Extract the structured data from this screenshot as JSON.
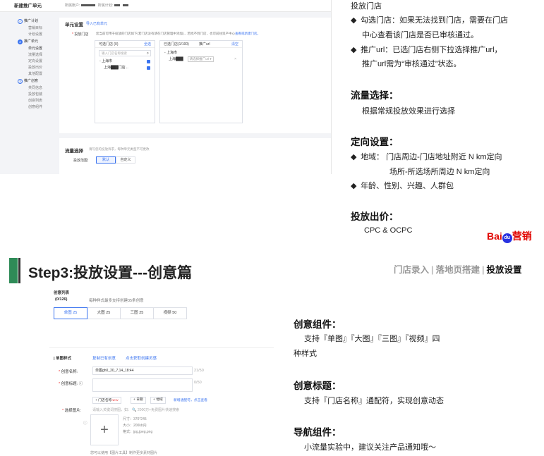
{
  "top_shot": {
    "header_title": "新建推广单元",
    "account_label": "所属账户:",
    "plan_label": "所属计划:",
    "sidebar": {
      "steps": [
        {
          "num": "✓",
          "label": "推广计划",
          "subs": [
            "营销目标",
            "计划设置"
          ]
        },
        {
          "num": "2",
          "label": "推广单元",
          "subs": [
            "单元设置",
            "流量选择",
            "定向设置",
            "投放出价",
            "其他配置"
          ]
        },
        {
          "num": "3",
          "label": "推广创意",
          "subs": [
            "共同信息",
            "投放包装",
            "创意列表",
            "创意组件"
          ]
        }
      ]
    },
    "unit": {
      "title": "单元设置",
      "title_link": "导入已有单元",
      "store_label": "投放门店",
      "store_hint": "您当前可用于投放的门店如下(若门店没有请在门店管理中添加)... 若找不到门店，也可前往资产中心",
      "store_hint_link": "查看或新建门店。",
      "left_panel": {
        "title": "可选门店 (0)",
        "action": "全选",
        "search_placeholder": "输入门店名称搜索",
        "rows": [
          "上海市",
          "上海███门店..."
        ]
      },
      "right_panel": {
        "title": "已选门店(1/100)",
        "mid": "推广url",
        "action": "清空",
        "rows": [
          "上海市",
          "上海███"
        ],
        "select_placeholder": "请选择推广url"
      }
    },
    "flow": {
      "title": "流量选择",
      "sub": "请写您的投放诉求，每种单元类型不可更改",
      "label": "投放范围:",
      "options": [
        "默认",
        "自定义"
      ],
      "selected": "默认"
    }
  },
  "notes_top": {
    "store_title": "投放门店",
    "items": [
      "勾选门店：如果无法找到门店，需要在门店",
      "中心查看该门店是否已审核通过。",
      "推广url：已选门店右侧下拉选择推广url，",
      "推广url需为“审核通过”状态。"
    ],
    "flow_title": "流量选择：",
    "flow_text": "根据常规投放效果进行选择",
    "target_title": "定向设置：",
    "target_items": [
      "地域： 门店周边-门店地址附近 N km定向",
      "场所-所选场所周边 N km定向",
      "年龄、性别、兴趣、人群包"
    ],
    "bid_title": "投放出价：",
    "bid_text": "CPC & OCPC"
  },
  "logo": {
    "bai": "Bai",
    "du": "du",
    "yx": "营销"
  },
  "step": {
    "title": "Step3:投放设置---创意篇",
    "crumbs": [
      "门店录入",
      "落地页搭建",
      "投放设置"
    ]
  },
  "bot_shot": {
    "list_title": "创意列表",
    "count": "(0/126)",
    "note": "每种样式最多支持创建35条创意",
    "tabs": [
      "单图 25",
      "大图 25",
      "三图 25",
      "视频 50"
    ],
    "style_label": "单图样式",
    "copy_link": "复制已有创意",
    "get_link": "点击获取创建灵感",
    "name_label": "创意名称:",
    "name_value": "单图gh0_20_7,14_18:44",
    "name_count": "21/50",
    "headline_label": "创意标题:",
    "headline_count": "0/50",
    "wildcard_btns": [
      "+ 门店名称",
      "+ 日期",
      "+ 地域"
    ],
    "new_tag": "NEW",
    "wildcard_link": "新增通配符，点击查看",
    "image_label": "选择图片:",
    "image_placeholder": "请输入关键词搜图，如：",
    "image_hint": "2000万+免费图片快速搜索",
    "upload_size": "尺寸：370*245",
    "upload_kb": "大小：200kb内",
    "upload_fmt": "格式：jpg,jpeg,png",
    "footer": "您可以使用【图片工具】制作更多素材图片"
  },
  "notes_bot": {
    "comp_title": "创意组件：",
    "comp_text1": "支持『单图』『大图』『三图』『视频』四",
    "comp_text2": "种样式",
    "title_title": "创意标题：",
    "title_text": "支持『门店名称』通配符，实现创意动态",
    "nav_title": "导航组件：",
    "nav_text": "小流量实验中，建议关注产品通知哦～"
  }
}
